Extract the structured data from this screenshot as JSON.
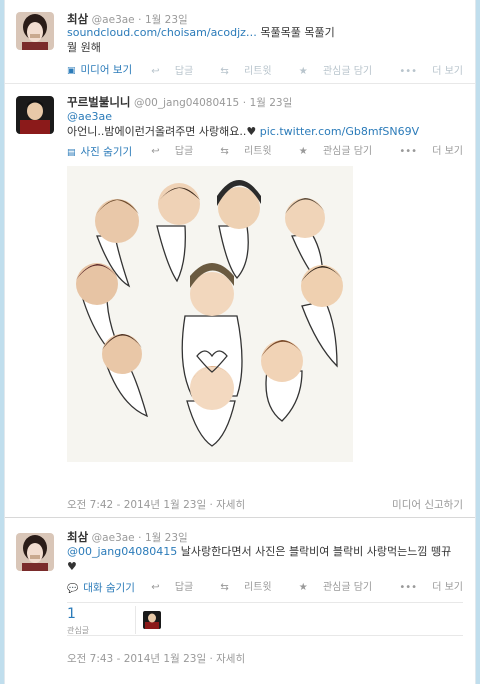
{
  "tweets": [
    {
      "fullname": "최삼",
      "handle": "@ae3ae",
      "dot": "·",
      "date": "1월 23일",
      "text_link": "soundcloud.com/choisam/acodjz…",
      "text_rest": " 목풀목풀 목풀기",
      "text_line2": "뭘 원해",
      "media_toggle": "미디어 보기",
      "actions": {
        "reply": "답글",
        "retweet": "리트윗",
        "favorite": "관심글 담기",
        "more": "더 보기"
      }
    },
    {
      "fullname": "꾸르벌불니니",
      "handle": "@00_jang04080415",
      "dot": "·",
      "date": "1월 23일",
      "mention": "@ae3ae",
      "text_main": "아언니..밤에이런거올려주면 사랑해요..♥ ",
      "text_link": "pic.twitter.com/Gb8mfSN69V",
      "media_toggle": "사진 숨기기",
      "actions": {
        "reply": "답글",
        "retweet": "리트윗",
        "favorite": "관심글 담기",
        "more": "더 보기"
      },
      "timestamp": "오전 7:42 - 2014년 1월 23일",
      "details": "자세히",
      "report": "미디어 신고하기"
    },
    {
      "fullname": "최삼",
      "handle": "@ae3ae",
      "dot": "·",
      "date": "1월 23일",
      "mention": "@00_jang04080415",
      "text_main": " 날사랑한다면서 사진은 블락비여 블락비 사랑먹는느낌 뗑뀨",
      "text_line2": "♥",
      "media_toggle": "대화 숨기기",
      "actions": {
        "reply": "답글",
        "retweet": "리트윗",
        "favorite": "관심글 담기",
        "more": "더 보기"
      },
      "stat_count": "1",
      "stat_label": "관심글",
      "timestamp": "오전 7:43 - 2014년 1월 23일",
      "details": "자세히"
    }
  ],
  "icons": {
    "reply": "↩",
    "retweet": "⇆",
    "favorite": "★",
    "more": "•••",
    "media": "▣",
    "photo": "▤",
    "conversation": "💬"
  },
  "colors": {
    "background": "#c0deed",
    "link": "#2b7bb9",
    "muted": "#999999"
  }
}
